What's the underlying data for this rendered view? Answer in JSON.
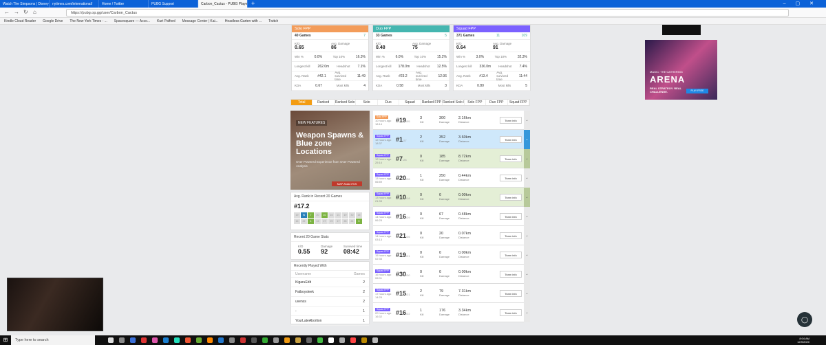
{
  "browser": {
    "tabs": [
      "Watch The Simpsons | Disney+",
      "nytimes.com/international/",
      "Home / Twitter",
      "PUBG Support",
      "Carbon_Cactus - PUBG Player"
    ],
    "new_tab": "+",
    "url": "https://pubg.op.gg/user/Carbon_Cactus",
    "bookmarks": [
      "Kindle Cloud Reader",
      "Google Drive",
      "The New York Times - ...",
      "Spacesquare — Acco...",
      "Kurt Pafford",
      "Message Center | Kai...",
      "Headless Garten with ...",
      "Twitch"
    ]
  },
  "cards": [
    {
      "mode": "Solo FPP",
      "color": "#f39c5a",
      "games": "40 Games",
      "badge": "7",
      "kd": "0.65",
      "avg_damage": "86",
      "win_pct": "0.0%",
      "top10": "16.3%",
      "longest_kill": "262.0m",
      "headshot": "7.1%",
      "avg_rank": "#42.1",
      "avg_survived": "11:49",
      "kda": "0.67",
      "most_kills": "4"
    },
    {
      "mode": "Duo FPP",
      "color": "#45b6b0",
      "games": "33 Games",
      "badge": "5",
      "kd": "0.48",
      "avg_damage": "75",
      "win_pct": "6.0%",
      "top10": "15.2%",
      "longest_kill": "178.0m",
      "headshot": "12.5%",
      "avg_rank": "#23.2",
      "avg_survived": "12:36",
      "kda": "0.58",
      "most_kills": "3"
    },
    {
      "mode": "Squad FPP",
      "color": "#7b61ff",
      "games": "371 Games",
      "badge": "11",
      "badge2": "109",
      "kd": "0.64",
      "avg_damage": "91",
      "win_pct": "3.0%",
      "top10": "32.3%",
      "longest_kill": "336.0m",
      "headshot": "7.4%",
      "avg_rank": "#13.4",
      "avg_survived": "11:44",
      "kda": "0.80",
      "most_kills": "5"
    }
  ],
  "labels": {
    "kd": "K/D",
    "avg_damage": "Avg. Damage",
    "win_pct": "Win %",
    "top10": "Top 10%",
    "longest_kill": "Longest kill",
    "headshot": "Headshot",
    "avg_rank": "Avg. Rank",
    "avg_survived": "Avg. survived time",
    "kda": "KDA",
    "most_kills": "Most kills"
  },
  "modes": [
    "Total",
    "Ranked",
    "Ranked Solo",
    "Solo",
    "Duo",
    "Squad",
    "Ranked FPP",
    "Ranked Solo FPP",
    "Solo FPP",
    "Duo FPP",
    "Squad FPP"
  ],
  "banner": {
    "tag": "NEW FEATURES",
    "title": "Weapon Spawns & Blue zone Locations",
    "subtitle": "Over Powered Experience from Over Powered Analysis",
    "button": "MAP ANALYSIS"
  },
  "avg_rank_panel": {
    "title": "Avg. Rank in Recent 20 Games",
    "value": "#17.2",
    "cells": [
      "19",
      "W",
      "7",
      "20",
      "10",
      "16",
      "21",
      "19",
      "30",
      "15",
      "16",
      "22",
      "4",
      "16",
      "27",
      "29",
      "17",
      "28",
      "24",
      "5"
    ]
  },
  "recent_stats": {
    "title": "Recent 20 Game Stats",
    "kd_label": "K/D",
    "kd": "0.55",
    "damage_label": "Damage",
    "damage": "92",
    "survived_label": "Survived time",
    "survived": "08:42"
  },
  "recently_played": {
    "title": "Recently Played With",
    "col_user": "Username",
    "col_games": "Games",
    "rows": [
      {
        "name": "KigaruEdit",
        "games": "2"
      },
      {
        "name": "Fatboysleek",
        "games": "2"
      },
      {
        "name": "uvenss",
        "games": "2"
      },
      {
        "name": "-",
        "games": "1"
      },
      {
        "name": "YourLateAbortion",
        "games": "1"
      }
    ]
  },
  "match_labels": {
    "kill": "Kill",
    "damage": "Damage",
    "distance": "Distance",
    "team_info": "Team info"
  },
  "matches": [
    {
      "ago": "10 hours ago",
      "time": "18:14",
      "rank": "#19",
      "total": "/95",
      "kills": "3",
      "damage": "300",
      "distance": "2.16km",
      "state": "normal",
      "badge": "Solo FPP"
    },
    {
      "ago": "12 hours ago",
      "time": "18:37",
      "rank": "#1",
      "total": "/27",
      "kills": "2",
      "damage": "352",
      "distance": "3.60km",
      "state": "win",
      "badge": "Squad FPP"
    },
    {
      "ago": "12 hours ago",
      "time": "25:14",
      "rank": "#7",
      "total": "/28",
      "kills": "0",
      "damage": "185",
      "distance": "8.72km",
      "state": "top10",
      "badge": "Squad FPP"
    },
    {
      "ago": "13 hours ago",
      "time": "06:59",
      "rank": "#20",
      "total": "/26",
      "kills": "1",
      "damage": "250",
      "distance": "0.44km",
      "state": "normal",
      "badge": "Squad FPP"
    },
    {
      "ago": "13 hours ago",
      "time": "21:33",
      "rank": "#10",
      "total": "/18",
      "kills": "0",
      "damage": "0",
      "distance": "0.00km",
      "state": "top10",
      "badge": "Squad FPP"
    },
    {
      "ago": "14 hours ago",
      "time": "06:25",
      "rank": "#16",
      "total": "/29",
      "kills": "0",
      "damage": "67",
      "distance": "0.48km",
      "state": "normal",
      "badge": "Squad FPP"
    },
    {
      "ago": "14 hours ago",
      "time": "03:13",
      "rank": "#21",
      "total": "/26",
      "kills": "0",
      "damage": "20",
      "distance": "0.07km",
      "state": "normal",
      "badge": "Squad FPP"
    },
    {
      "ago": "15 hours ago",
      "time": "02:35",
      "rank": "#19",
      "total": "/21",
      "kills": "0",
      "damage": "0",
      "distance": "0.00km",
      "state": "normal",
      "badge": "Squad FPP"
    },
    {
      "ago": "16 hours ago",
      "time": "06:01",
      "rank": "#30",
      "total": "/30",
      "kills": "0",
      "damage": "0",
      "distance": "0.00km",
      "state": "normal",
      "badge": "Squad FPP"
    },
    {
      "ago": "17 hours ago",
      "time": "14:25",
      "rank": "#15",
      "total": "/21",
      "kills": "2",
      "damage": "79",
      "distance": "7.31km",
      "state": "normal",
      "badge": "Squad FPP"
    },
    {
      "ago": "20 hours ago",
      "time": "16:32",
      "rank": "#16",
      "total": "/22",
      "kills": "1",
      "damage": "176",
      "distance": "3.34km",
      "state": "normal",
      "badge": "Squad FPP"
    }
  ],
  "ad": {
    "line1": "MAGIC: THE GATHERING",
    "title": "ARENA",
    "tagline": "REAL STRATEGY. REAL CHALLENGE.",
    "button": "PLAY FREE"
  },
  "taskbar": {
    "search_placeholder": "Type here to search",
    "time": "8:04 AM",
    "date": "12/9/2020"
  }
}
